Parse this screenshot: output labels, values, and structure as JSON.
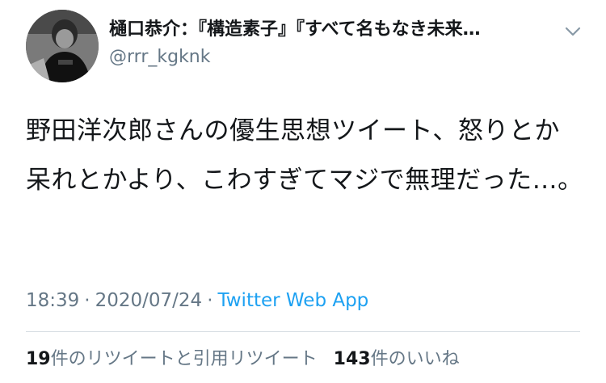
{
  "author": {
    "display_name": "樋口恭介：『構造素子』『すべて名もなき未来…",
    "handle": "@rrr_kgknk",
    "avatar_icon": "user-avatar-photo",
    "menu_icon": "chevron-down-icon"
  },
  "tweet": {
    "text": "野田洋次郎さんの優生思想ツイート、怒りとか呆れとかより、こわすぎてマジで無理だった…。",
    "time": "18:39",
    "separator": "·",
    "date": "2020/07/24",
    "source": "Twitter Web App"
  },
  "stats": {
    "retweets_count": "19",
    "retweets_label": "件のリツイートと引用リツイート",
    "likes_count": "143",
    "likes_label": "件のいいね"
  },
  "colors": {
    "text": "#14171a",
    "secondary": "#657786",
    "link": "#1da1f2",
    "divider": "#d5dce1"
  }
}
